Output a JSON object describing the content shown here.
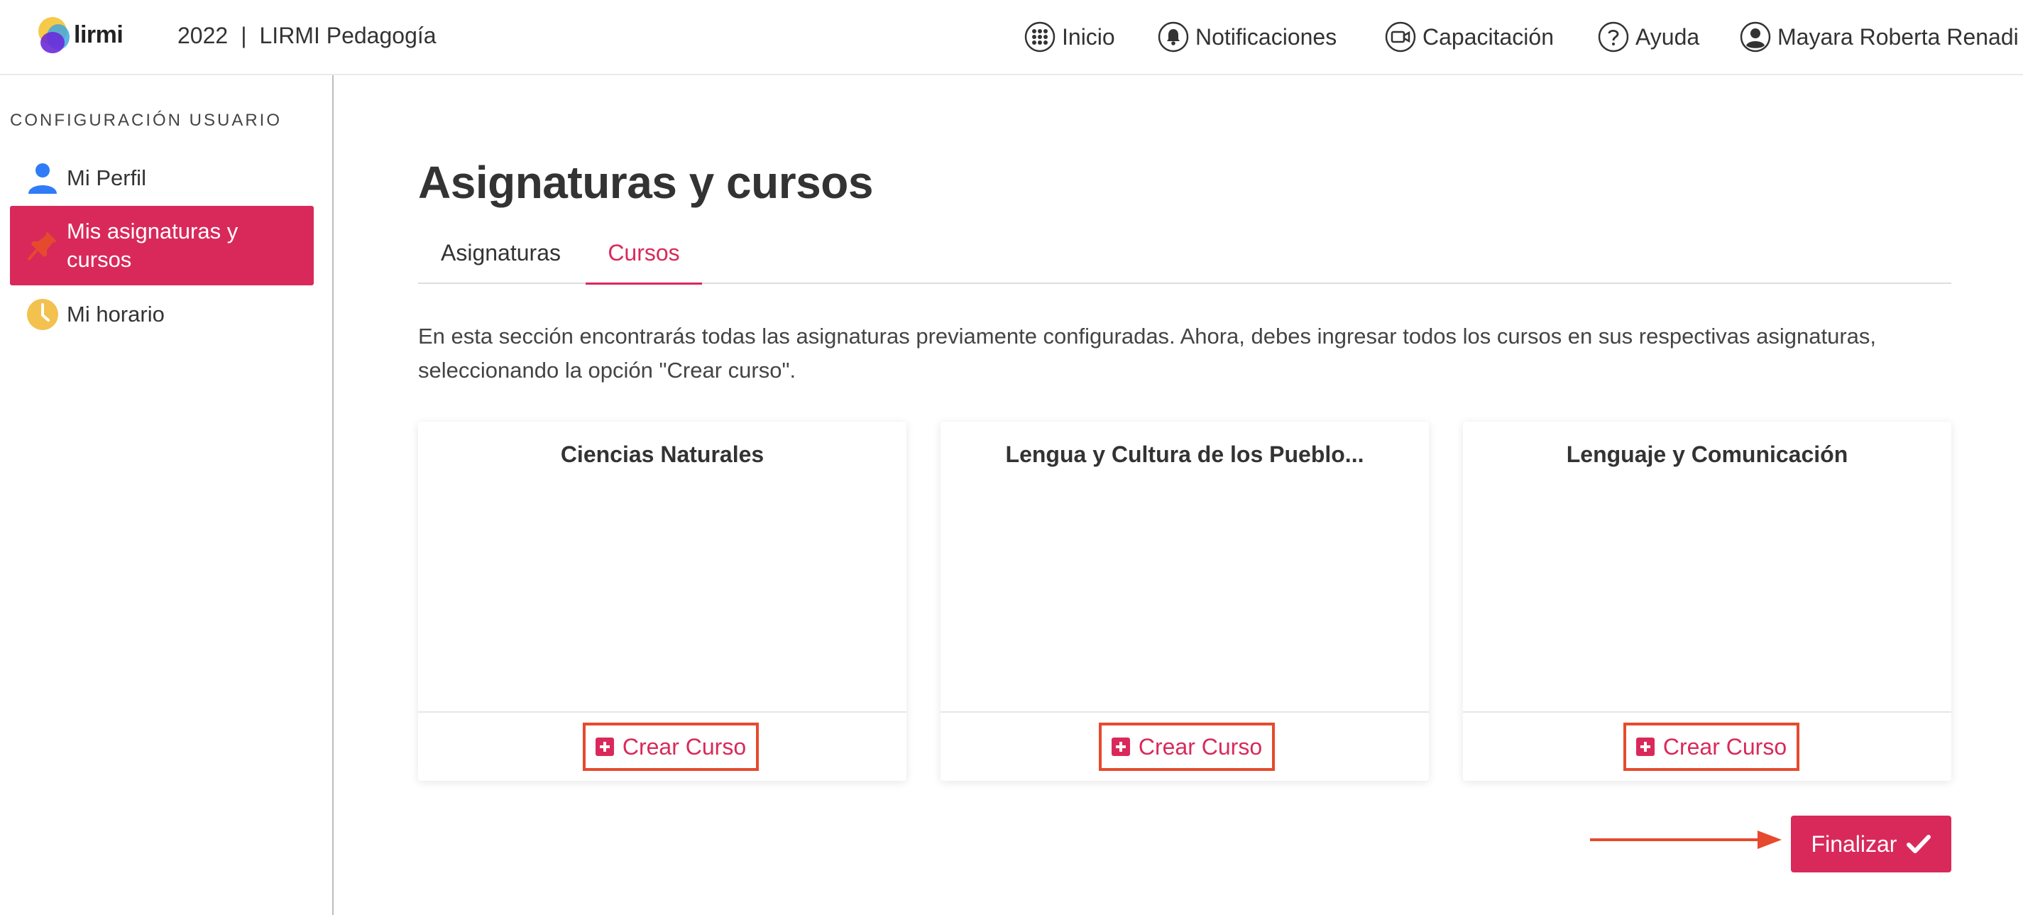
{
  "header": {
    "logo_text": "lirmi",
    "year": "2022",
    "separator": "|",
    "context": "LIRMI Pedagogía",
    "nav": [
      {
        "label": "Inicio",
        "icon": "grid-icon"
      },
      {
        "label": "Notificaciones",
        "icon": "bell-icon"
      },
      {
        "label": "Capacitación",
        "icon": "video-icon"
      },
      {
        "label": "Ayuda",
        "icon": "help-icon"
      },
      {
        "label": "Mayara Roberta Renadi",
        "icon": "user-avatar-icon"
      }
    ]
  },
  "sidebar": {
    "heading": "CONFIGURACIÓN USUARIO",
    "items": [
      {
        "label": "Mi Perfil",
        "icon": "person-icon",
        "icon_color": "#2f7cf6"
      },
      {
        "label_line1": "Mis asignaturas y",
        "label_line2": "cursos",
        "icon": "pin-icon",
        "icon_color": "#e64a2e",
        "active": true
      },
      {
        "label": "Mi horario",
        "icon": "clock-icon",
        "icon_color": "#f2c14e"
      }
    ]
  },
  "main": {
    "title": "Asignaturas y cursos",
    "tabs": [
      {
        "label": "Asignaturas",
        "active": false
      },
      {
        "label": "Cursos",
        "active": true
      }
    ],
    "intro_line1": "En esta sección encontrarás todas las asignaturas previamente configuradas. Ahora, debes ingresar todos los cursos en sus respectivas asignaturas,",
    "intro_line2": "seleccionando la opción \"Crear curso\".",
    "cards": [
      {
        "title": "Ciencias Naturales",
        "button": "Crear Curso"
      },
      {
        "title": "Lengua y Cultura de los Pueblo...",
        "button": "Crear Curso"
      },
      {
        "title": "Lenguaje y Comunicación",
        "button": "Crear Curso"
      }
    ],
    "finalize_label": "Finalizar"
  },
  "colors": {
    "accent": "#d9295a",
    "highlight_border": "#e64a2e"
  }
}
